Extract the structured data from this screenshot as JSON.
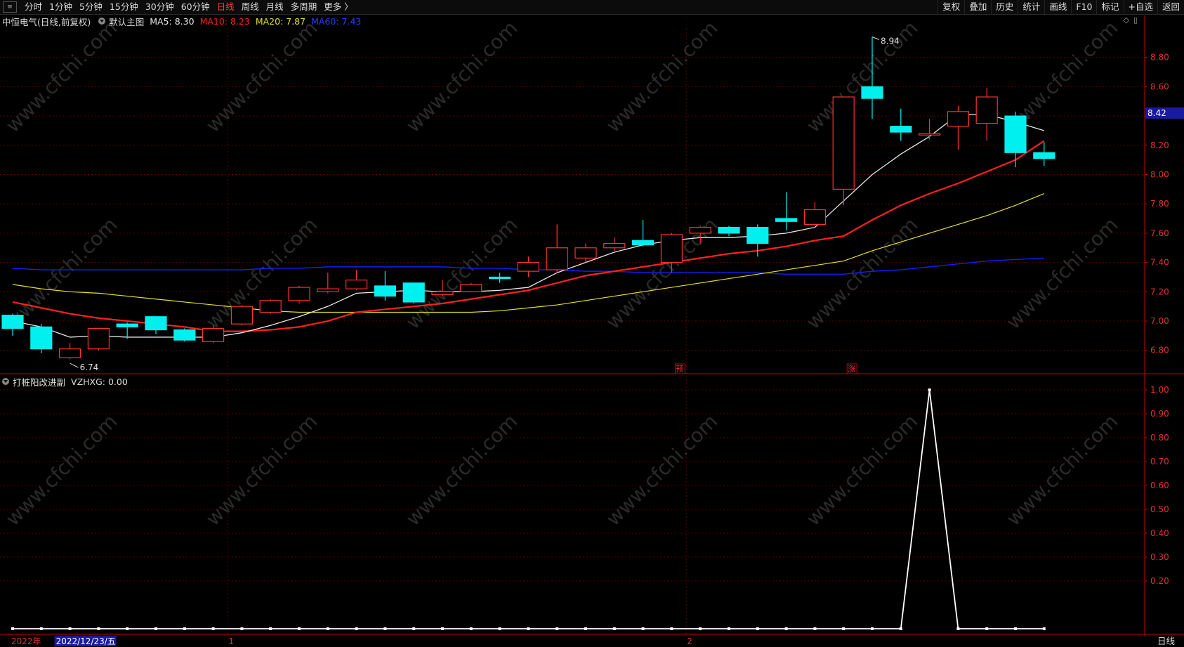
{
  "toolbar": {
    "periods": [
      {
        "label": "分时",
        "active": false
      },
      {
        "label": "1分钟",
        "active": false
      },
      {
        "label": "5分钟",
        "active": false
      },
      {
        "label": "15分钟",
        "active": false
      },
      {
        "label": "30分钟",
        "active": false
      },
      {
        "label": "60分钟",
        "active": false
      },
      {
        "label": "日线",
        "active": true
      },
      {
        "label": "周线",
        "active": false
      },
      {
        "label": "月线",
        "active": false
      },
      {
        "label": "多周期",
        "active": false
      },
      {
        "label": "更多 〉",
        "active": false
      }
    ],
    "right_buttons": [
      "复权",
      "叠加",
      "历史",
      "统计",
      "画线",
      "F10",
      "标记",
      "+自选",
      "返回"
    ]
  },
  "main_info": {
    "title": "中恒电气(日线,前复权)",
    "template": "默认主图",
    "ma5": "MA5: 8.30",
    "ma10": "MA10: 8.23",
    "ma20": "MA20: 7.87",
    "ma60": "MA60: 7.43"
  },
  "indicator_info": {
    "name": "打桩阳改进副",
    "value": "VZHXG: 0.00"
  },
  "colors": {
    "up": "#ff3030",
    "down": "#00f0f0",
    "ma5": "#e8e8e8",
    "ma10": "#ff2020",
    "ma20": "#e8e020",
    "ma60": "#1020ff",
    "grid": "#5a0000",
    "axis": "#c80000"
  },
  "chart_data": {
    "type": "candlestick",
    "price_axis": {
      "ticks": [
        "8.80",
        "8.60",
        "8.40",
        "8.20",
        "8.00",
        "7.80",
        "7.60",
        "7.40",
        "7.20",
        "7.00",
        "6.80"
      ],
      "min": 6.65,
      "max": 9.0
    },
    "current_price_label": "8.42",
    "max_label": "8.94",
    "min_label": "6.74",
    "candles": [
      {
        "o": 7.04,
        "h": 7.05,
        "l": 6.9,
        "c": 6.95
      },
      {
        "o": 6.96,
        "h": 6.98,
        "l": 6.78,
        "c": 6.81
      },
      {
        "o": 6.75,
        "h": 6.85,
        "l": 6.74,
        "c": 6.81
      },
      {
        "o": 6.81,
        "h": 6.95,
        "l": 6.8,
        "c": 6.95
      },
      {
        "o": 6.98,
        "h": 6.99,
        "l": 6.88,
        "c": 6.96
      },
      {
        "o": 7.03,
        "h": 7.03,
        "l": 6.91,
        "c": 6.94
      },
      {
        "o": 6.94,
        "h": 6.95,
        "l": 6.86,
        "c": 6.87
      },
      {
        "o": 6.86,
        "h": 6.97,
        "l": 6.85,
        "c": 6.95
      },
      {
        "o": 6.98,
        "h": 7.11,
        "l": 6.97,
        "c": 7.1
      },
      {
        "o": 7.06,
        "h": 7.15,
        "l": 7.05,
        "c": 7.14
      },
      {
        "o": 7.14,
        "h": 7.24,
        "l": 7.12,
        "c": 7.23
      },
      {
        "o": 7.2,
        "h": 7.33,
        "l": 7.19,
        "c": 7.22
      },
      {
        "o": 7.22,
        "h": 7.35,
        "l": 7.21,
        "c": 7.28
      },
      {
        "o": 7.24,
        "h": 7.34,
        "l": 7.14,
        "c": 7.17
      },
      {
        "o": 7.26,
        "h": 7.26,
        "l": 7.12,
        "c": 7.13
      },
      {
        "o": 7.18,
        "h": 7.28,
        "l": 7.17,
        "c": 7.2
      },
      {
        "o": 7.2,
        "h": 7.26,
        "l": 7.2,
        "c": 7.25
      },
      {
        "o": 7.3,
        "h": 7.33,
        "l": 7.26,
        "c": 7.29
      },
      {
        "o": 7.34,
        "h": 7.44,
        "l": 7.3,
        "c": 7.4
      },
      {
        "o": 7.35,
        "h": 7.66,
        "l": 7.33,
        "c": 7.5
      },
      {
        "o": 7.43,
        "h": 7.53,
        "l": 7.4,
        "c": 7.5
      },
      {
        "o": 7.5,
        "h": 7.57,
        "l": 7.48,
        "c": 7.53
      },
      {
        "o": 7.55,
        "h": 7.69,
        "l": 7.51,
        "c": 7.52
      },
      {
        "o": 7.4,
        "h": 7.6,
        "l": 7.33,
        "c": 7.59
      },
      {
        "o": 7.6,
        "h": 7.65,
        "l": 7.53,
        "c": 7.64
      },
      {
        "o": 7.64,
        "h": 7.65,
        "l": 7.58,
        "c": 7.6
      },
      {
        "o": 7.64,
        "h": 7.66,
        "l": 7.44,
        "c": 7.53
      },
      {
        "o": 7.7,
        "h": 7.88,
        "l": 7.62,
        "c": 7.68
      },
      {
        "o": 7.66,
        "h": 7.81,
        "l": 7.65,
        "c": 7.76
      },
      {
        "o": 7.9,
        "h": 8.53,
        "l": 7.79,
        "c": 8.53
      },
      {
        "o": 8.6,
        "h": 8.94,
        "l": 8.38,
        "c": 8.52
      },
      {
        "o": 8.33,
        "h": 8.45,
        "l": 8.23,
        "c": 8.29
      },
      {
        "o": 8.27,
        "h": 8.38,
        "l": 8.24,
        "c": 8.28
      },
      {
        "o": 8.33,
        "h": 8.47,
        "l": 8.17,
        "c": 8.43
      },
      {
        "o": 8.35,
        "h": 8.59,
        "l": 8.23,
        "c": 8.53
      },
      {
        "o": 8.4,
        "h": 8.43,
        "l": 8.05,
        "c": 8.15
      },
      {
        "o": 8.15,
        "h": 8.22,
        "l": 8.06,
        "c": 8.11
      }
    ],
    "ma5": [
      7.0,
      6.96,
      6.89,
      6.9,
      6.89,
      6.89,
      6.89,
      6.89,
      6.92,
      6.97,
      7.03,
      7.1,
      7.19,
      7.2,
      7.21,
      7.2,
      7.2,
      7.21,
      7.23,
      7.33,
      7.4,
      7.47,
      7.52,
      7.55,
      7.57,
      7.57,
      7.58,
      7.6,
      7.64,
      7.82,
      8.0,
      8.14,
      8.26,
      8.41,
      8.41,
      8.36,
      8.3
    ],
    "ma10": [
      7.13,
      7.09,
      7.05,
      7.02,
      7.0,
      6.98,
      6.96,
      6.93,
      6.93,
      6.94,
      6.96,
      7.0,
      7.06,
      7.08,
      7.1,
      7.12,
      7.15,
      7.18,
      7.21,
      7.26,
      7.31,
      7.34,
      7.37,
      7.4,
      7.43,
      7.46,
      7.48,
      7.51,
      7.55,
      7.58,
      7.69,
      7.79,
      7.87,
      7.94,
      8.02,
      8.1,
      8.23
    ],
    "ma20": [
      7.25,
      7.22,
      7.2,
      7.19,
      7.17,
      7.15,
      7.13,
      7.11,
      7.09,
      7.07,
      7.06,
      7.06,
      7.06,
      7.06,
      7.06,
      7.06,
      7.06,
      7.07,
      7.09,
      7.11,
      7.14,
      7.17,
      7.2,
      7.23,
      7.26,
      7.29,
      7.32,
      7.35,
      7.38,
      7.41,
      7.48,
      7.54,
      7.6,
      7.66,
      7.72,
      7.79,
      7.87
    ],
    "ma60": [
      7.36,
      7.35,
      7.35,
      7.35,
      7.35,
      7.35,
      7.35,
      7.35,
      7.35,
      7.36,
      7.36,
      7.37,
      7.37,
      7.37,
      7.37,
      7.37,
      7.36,
      7.36,
      7.35,
      7.35,
      7.34,
      7.34,
      7.33,
      7.33,
      7.33,
      7.33,
      7.33,
      7.32,
      7.32,
      7.32,
      7.34,
      7.35,
      7.37,
      7.39,
      7.41,
      7.42,
      7.43
    ],
    "signals": [
      {
        "index": 23,
        "label": "预"
      },
      {
        "index": 29,
        "label": "涨"
      }
    ],
    "indicator": {
      "name": "VZHXG",
      "ticks": [
        "1.00",
        "0.90",
        "0.80",
        "0.70",
        "0.60",
        "0.50",
        "0.40",
        "0.30",
        "0.20"
      ],
      "min": 0,
      "max": 1.0,
      "values": [
        0,
        0,
        0,
        0,
        0,
        0,
        0,
        0,
        0,
        0,
        0,
        0,
        0,
        0,
        0,
        0,
        0,
        0,
        0,
        0,
        0,
        0,
        0,
        0,
        0,
        0,
        0,
        0,
        0,
        0,
        0,
        0,
        1,
        0,
        0,
        0,
        0
      ]
    },
    "x_labels": [
      {
        "index": 0,
        "label": "2022年",
        "style": "red"
      },
      {
        "index": 2,
        "label": "2022/12/23/五",
        "style": "cursor"
      },
      {
        "index": 8,
        "label": "1",
        "style": "red"
      },
      {
        "index": 24,
        "label": "2",
        "style": "red"
      }
    ],
    "period_label": "日线"
  }
}
